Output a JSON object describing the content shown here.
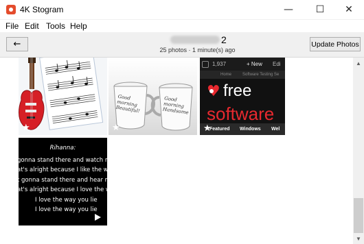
{
  "window": {
    "title": "4K Stogram",
    "controls": {
      "minimize": "—",
      "maximize": "☐",
      "close": "✕"
    }
  },
  "menu": [
    "File",
    "Edit",
    "Tools",
    "Help"
  ],
  "toolbar": {
    "back_icon": "←",
    "profile_suffix": "2",
    "meta": "25 photos · 1 minute(s) ago",
    "update_label": "Update Photos"
  },
  "thumbnails": {
    "mugs": {
      "text1": "Good morning Beautiful!",
      "text2": "Good morning Handsome"
    },
    "website": {
      "count": "1,937",
      "new": "+ New",
      "edit": "Edi",
      "subnav": [
        "Home",
        "Software Testing Se"
      ],
      "logo_word1": "free",
      "logo_word2": "software",
      "nav": [
        "Featured",
        "Windows",
        "Wel"
      ]
    },
    "video": {
      "lines": [
        "Rihanna:",
        "gonna stand there and watch me b",
        "at's alright because I like the way it",
        "t gonna stand there and hear me c",
        "at's alright because I love the way it",
        "I love the way you lie",
        "I love the way you lie"
      ]
    }
  },
  "icons": {
    "star": "★",
    "scroll_up": "▲",
    "scroll_down": "▼"
  },
  "colors": {
    "app_icon": "#e44c2c",
    "toolbar_bg": "#f0f0f0",
    "logo_red": "#e8292f"
  }
}
